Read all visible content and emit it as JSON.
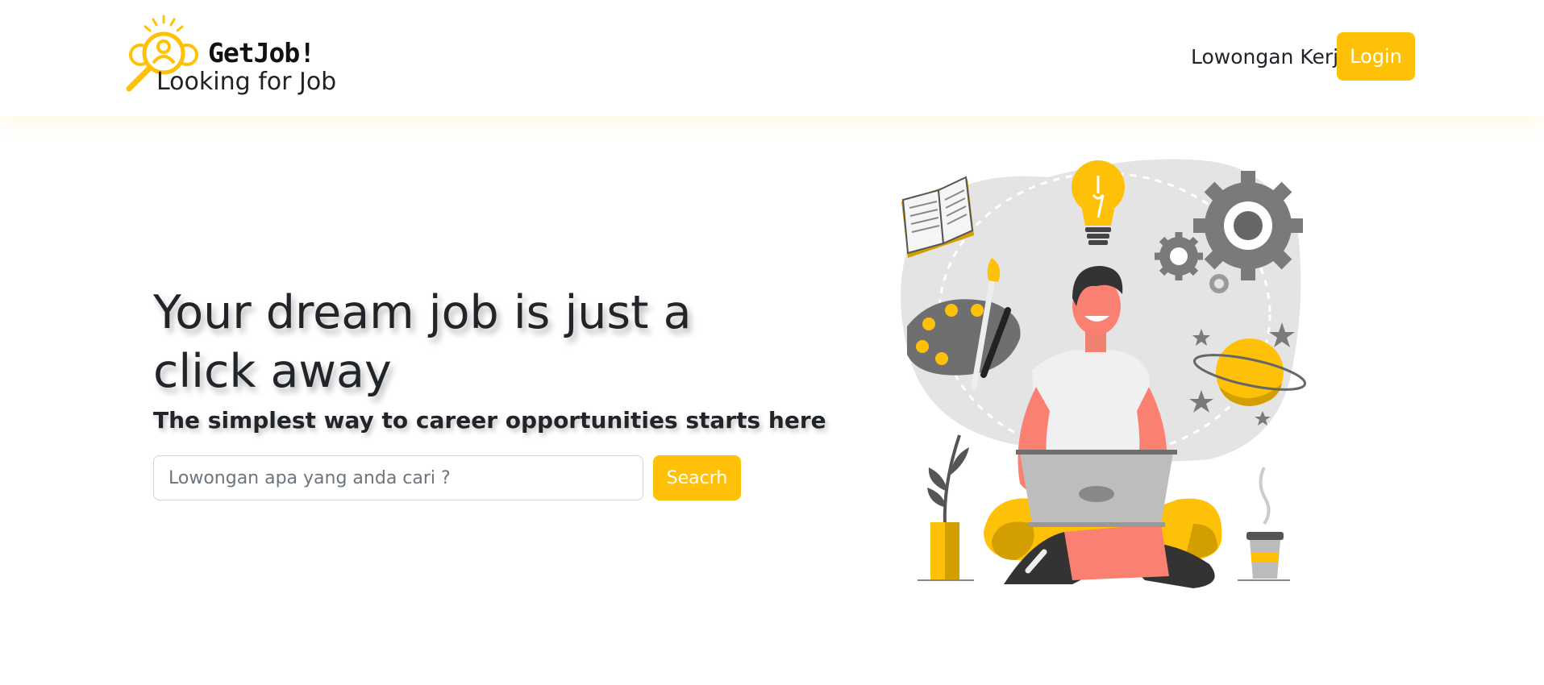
{
  "navbar": {
    "brand_name": "GetJob!",
    "brand_tagline": "Looking for Job",
    "nav_link_label": "Lowongan Kerja",
    "login_label": "Login"
  },
  "hero": {
    "title": "Your dream job is just a click away",
    "subtitle": "The simplest way to career opportunities starts here",
    "search": {
      "placeholder": "Lowongan apa yang anda cari ?",
      "value": "",
      "button_label": "Seacrh"
    }
  },
  "colors": {
    "accent": "#ffc107",
    "text": "#212529",
    "placeholder": "#6c757d"
  },
  "icons": {
    "brand": "logo-icon",
    "illustration": "freelancer-illustration"
  }
}
